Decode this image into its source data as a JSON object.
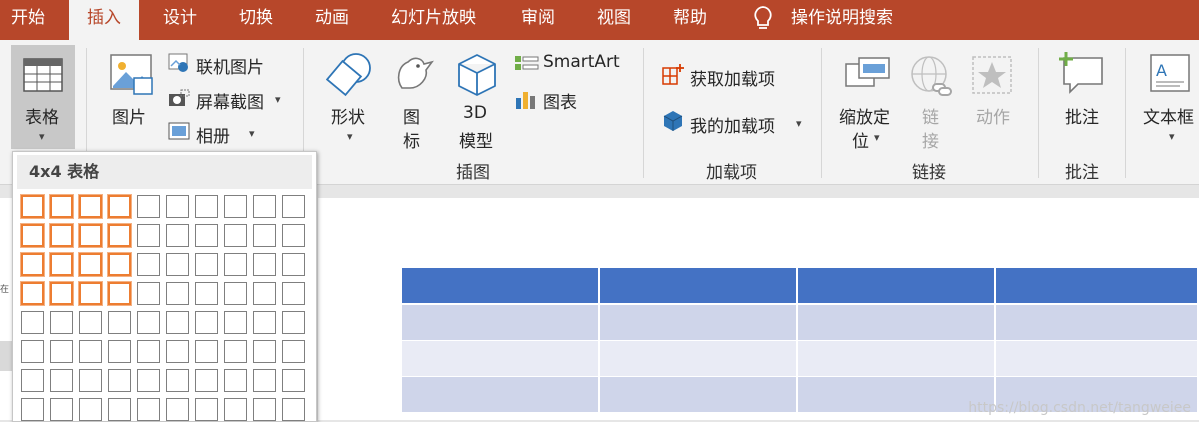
{
  "tabs": [
    {
      "label": "开始",
      "active": false
    },
    {
      "label": "插入",
      "active": true
    },
    {
      "label": "设计",
      "active": false
    },
    {
      "label": "切换",
      "active": false
    },
    {
      "label": "动画",
      "active": false
    },
    {
      "label": "幻灯片放映",
      "active": false
    },
    {
      "label": "审阅",
      "active": false
    },
    {
      "label": "视图",
      "active": false
    },
    {
      "label": "帮助",
      "active": false
    }
  ],
  "tell_me": {
    "label": "操作说明搜索",
    "icon": "lightbulb-icon"
  },
  "ribbon": {
    "table": {
      "label": "表格",
      "icon": "table-icon"
    },
    "images": {
      "picture": {
        "label": "图片",
        "icon": "picture-icon"
      },
      "online_pictures": {
        "label": "联机图片",
        "icon": "online-picture-icon"
      },
      "screenshot": {
        "label": "屏幕截图",
        "icon": "screenshot-icon"
      },
      "album": {
        "label": "相册",
        "icon": "album-icon"
      }
    },
    "illustrations": {
      "shapes": {
        "label": "形状",
        "icon": "shapes-icon"
      },
      "icons_line1": "图",
      "icons_line2": "标",
      "models_line1": "3D",
      "models_line2": "模型",
      "smartart": {
        "label": "SmartArt",
        "icon": "smartart-icon"
      },
      "chart": {
        "label": "图表",
        "icon": "chart-icon"
      },
      "group_label": "插图"
    },
    "addins": {
      "get": {
        "label": "获取加载项",
        "icon": "store-icon"
      },
      "my": {
        "label": "我的加载项",
        "icon": "my-addins-icon"
      },
      "group_label": "加载项"
    },
    "links": {
      "zoom_line1": "缩放定",
      "zoom_line2": "位",
      "link_line1": "链",
      "link_line2": "接",
      "action": "动作",
      "group_label": "链接"
    },
    "comments": {
      "label": "批注",
      "group_label": "批注",
      "icon": "comment-icon"
    },
    "text": {
      "textbox": "文本框",
      "icon": "textbox-icon"
    }
  },
  "table_dropdown": {
    "header": "4x4 表格",
    "rows": 8,
    "cols": 10,
    "selected_rows": 4,
    "selected_cols": 4,
    "visible_rows": 8
  },
  "slide": {
    "header_color": "#4472c4",
    "band_color": "#cfd5ea",
    "band_alt_color": "#e9ebf5"
  },
  "watermark": "https://blog.csdn.net/tangweiee",
  "side_text": "在"
}
